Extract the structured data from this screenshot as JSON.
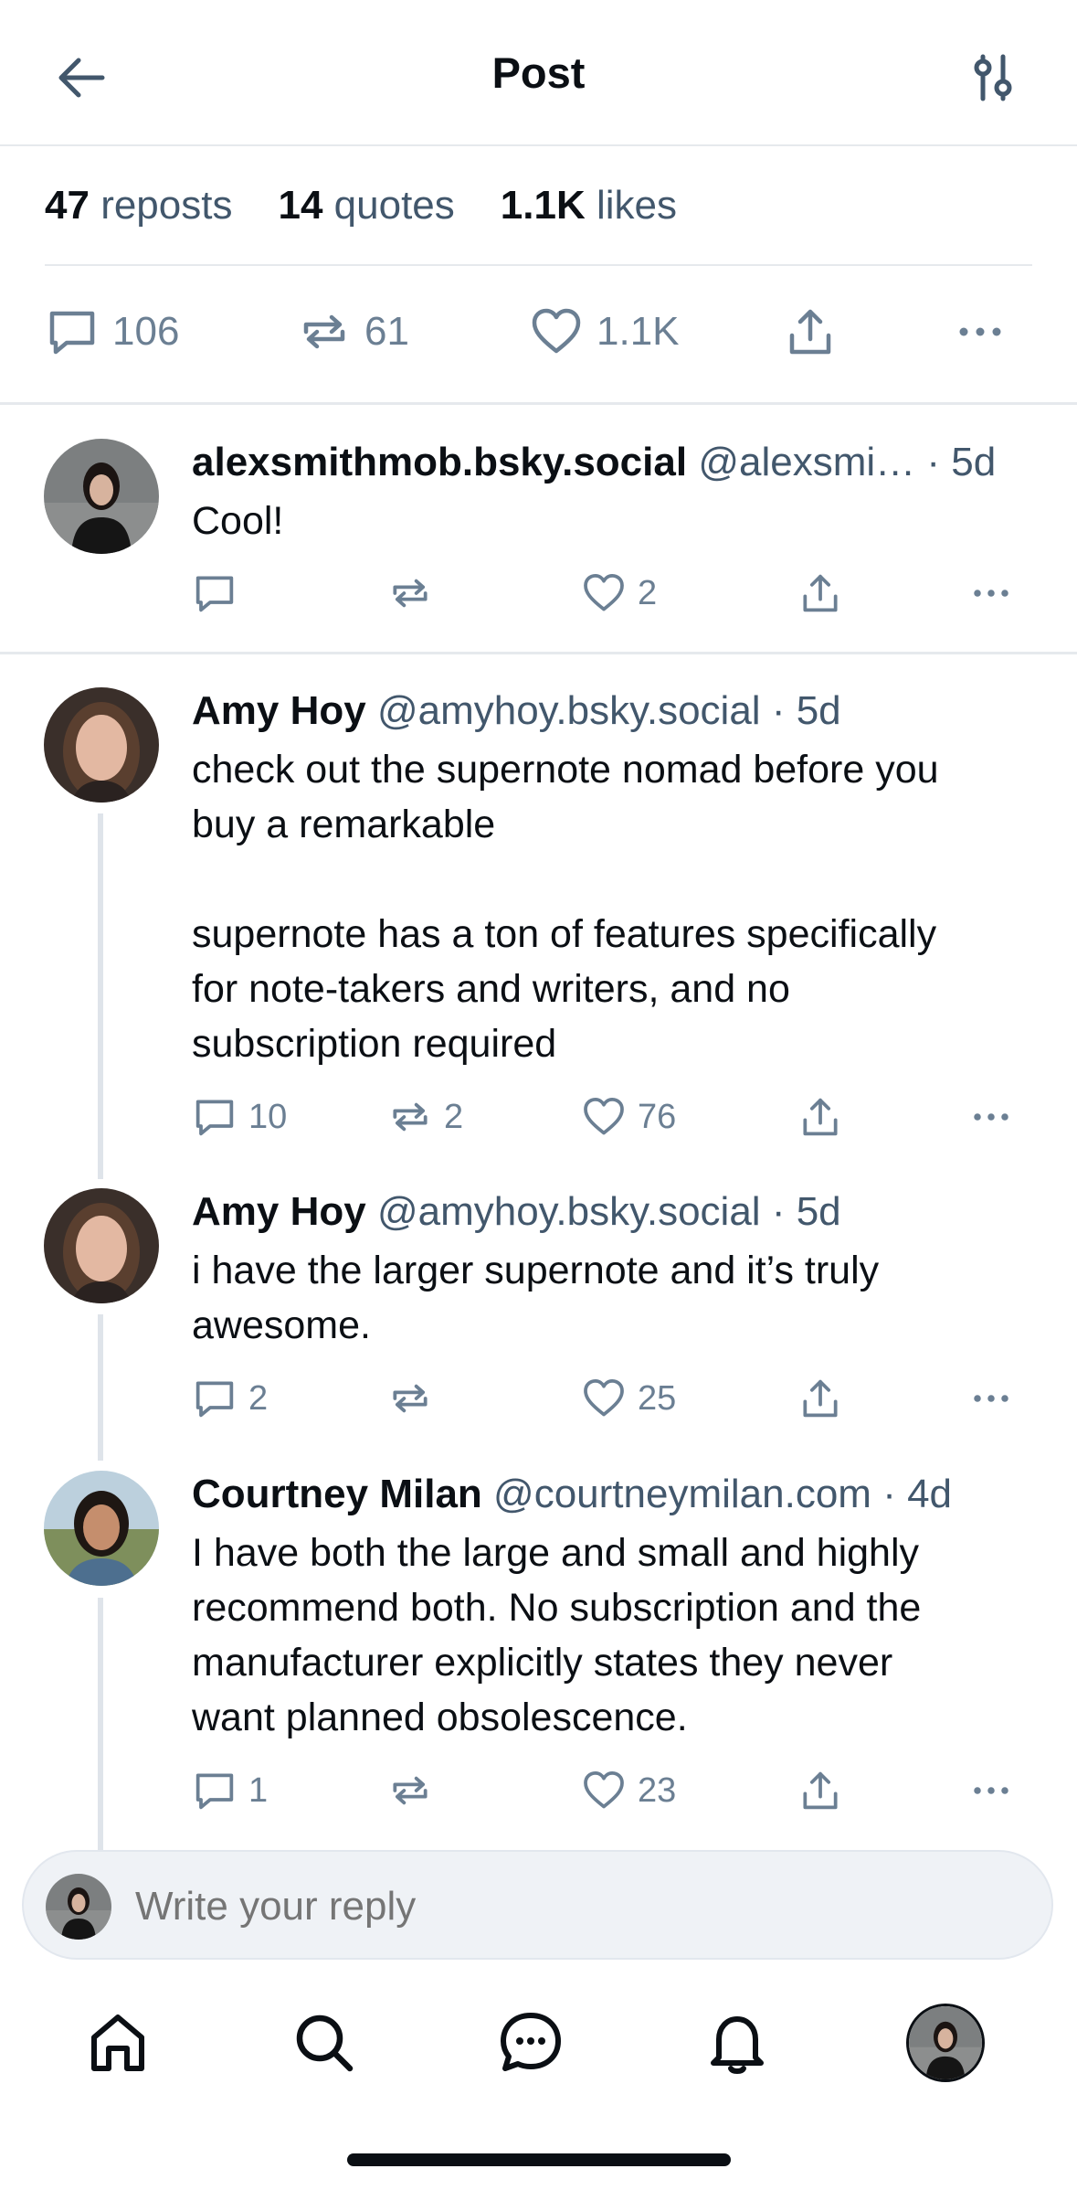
{
  "header": {
    "title": "Post",
    "back_icon": "arrow-left-icon",
    "filter_icon": "sliders-icon"
  },
  "stats": {
    "reposts_count": "47",
    "reposts_label": "reposts",
    "quotes_count": "14",
    "quotes_label": "quotes",
    "likes_count": "1.1K",
    "likes_label": "likes"
  },
  "main_actions": {
    "replies": "106",
    "reposts": "61",
    "likes": "1.1K"
  },
  "posts": [
    {
      "name": "alexsmithmob.bsky.social",
      "handle": "@alexsmi…",
      "time": "· 5d",
      "body": "Cool!",
      "replies": "",
      "reposts": "",
      "likes": "2"
    },
    {
      "name": "Amy Hoy",
      "handle": "@amyhoy.bsky.social",
      "time": "· 5d",
      "body": "check out the supernote nomad before you\nbuy a remarkable\n\nsupernote has a ton of features specifically\nfor note-takers and writers, and no\nsubscription required",
      "replies": "10",
      "reposts": "2",
      "likes": "76"
    },
    {
      "name": "Amy Hoy",
      "handle": "@amyhoy.bsky.social",
      "time": "· 5d",
      "body": "i have the larger supernote and it’s truly\nawesome.",
      "replies": "2",
      "reposts": "",
      "likes": "25"
    },
    {
      "name": "Courtney Milan",
      "handle": "@courtneymilan.com",
      "time": "· 4d",
      "body": "I have both the large and small and highly\nrecommend both. No subscription and the\nmanufacturer explicitly states they never\nwant planned obsolescence.",
      "replies": "1",
      "reposts": "",
      "likes": "23"
    }
  ],
  "reply_box": {
    "placeholder": "Write your reply"
  },
  "tab_bar": {
    "items": [
      "home-icon",
      "search-icon",
      "chat-icon",
      "bell-icon",
      "profile-avatar"
    ]
  },
  "colors": {
    "text": "#0b0f14",
    "secondary": "#42576c",
    "icon": "#6b7f93",
    "divider": "#e6e9ed",
    "reply_bg": "#eff2f6"
  }
}
